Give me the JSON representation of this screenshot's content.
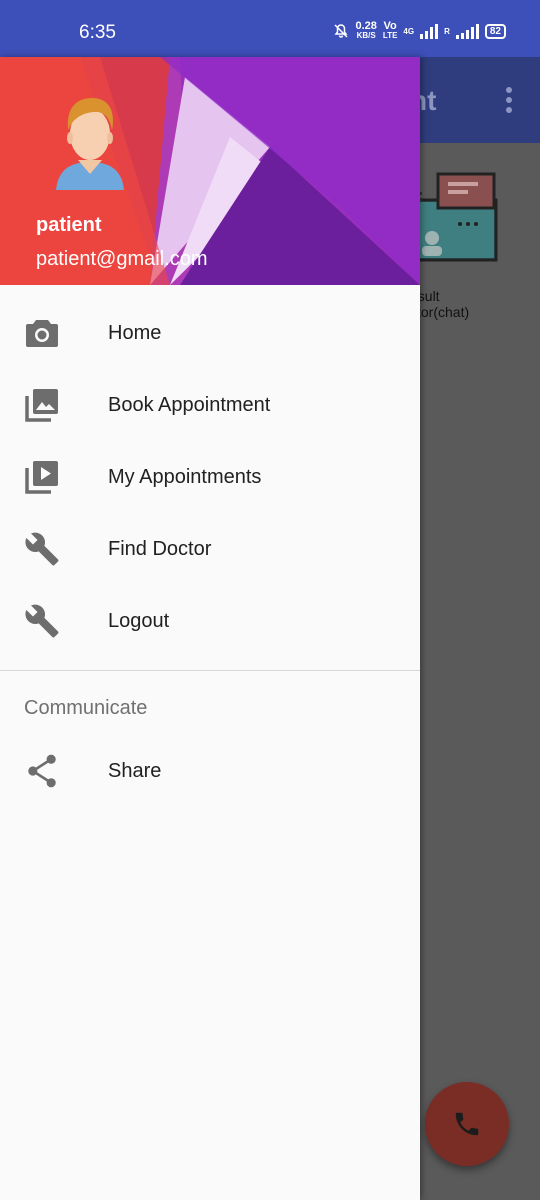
{
  "status_bar": {
    "time": "6:35",
    "net_speed": "0.28",
    "net_unit": "KB/S",
    "volte_top": "Vo",
    "volte_bottom": "LTE",
    "network_type": "4G",
    "roaming": "R",
    "battery": "82"
  },
  "background_app": {
    "toolbar_title_fragment": "nt",
    "card_label_line1": "nsult",
    "card_label_line2": "ctor(chat)"
  },
  "drawer": {
    "header": {
      "user_name": "patient",
      "user_email": "patient@gmail.com"
    },
    "items": [
      {
        "label": "Home",
        "icon": "camera-icon"
      },
      {
        "label": "Book Appointment",
        "icon": "photo-library-icon"
      },
      {
        "label": "My Appointments",
        "icon": "video-library-icon"
      },
      {
        "label": "Find Doctor",
        "icon": "wrench-icon"
      },
      {
        "label": "Logout",
        "icon": "wrench-icon"
      }
    ],
    "section_title": "Communicate",
    "section_items": [
      {
        "label": "Share",
        "icon": "share-icon"
      }
    ]
  },
  "colors": {
    "status_bar": "#3d4fb8",
    "header_red": "#e53935",
    "header_purple": "#8e24aa",
    "icon_gray": "#6d6d6d",
    "fab": "#7a2d24"
  }
}
